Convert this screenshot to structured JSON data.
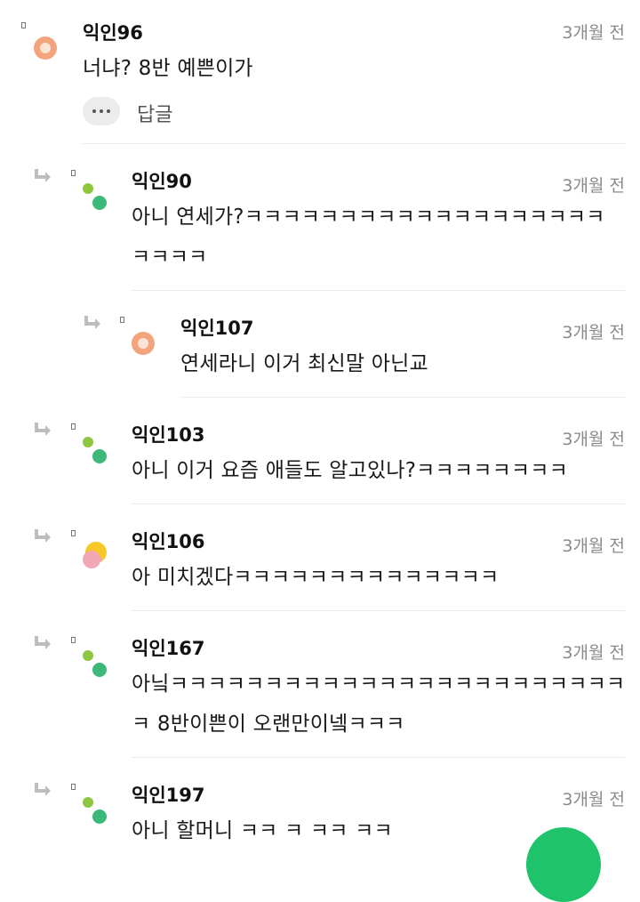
{
  "comments": [
    {
      "author": "익인96",
      "time": "3개월 전",
      "lines": [
        "너냐? 8반 예쁜이가"
      ],
      "avatar": "orange-circle-avatar"
    },
    {
      "author": "익인90",
      "time": "3개월 전",
      "lines": [
        "아니 연세가?ㅋㅋㅋㅋㅋㅋㅋㅋㅋㅋㅋㅋㅋㅋㅋㅋㅋㅋㅋ",
        "ㅋㅋㅋㅋ"
      ],
      "avatar": "green-dots-avatar"
    },
    {
      "author": "익인107",
      "time": "3개월 전",
      "lines": [
        "연세라니 이거 최신말 아닌교"
      ],
      "avatar": "orange-circle-avatar"
    },
    {
      "author": "익인103",
      "time": "3개월 전",
      "lines": [
        "아니 이거 요즘 애들도 알고있나?ㅋㅋㅋㅋㅋㅋㅋㅋ"
      ],
      "avatar": "green-dots-avatar"
    },
    {
      "author": "익인106",
      "time": "3개월 전",
      "lines": [
        "아 미치겠다ㅋㅋㅋㅋㅋㅋㅋㅋㅋㅋㅋㅋㅋㅋ"
      ],
      "avatar": "yellow-pink-avatar"
    },
    {
      "author": "익인167",
      "time": "3개월 전",
      "lines": [
        "아닠ㅋㅋㅋㅋㅋㅋㅋㅋㅋㅋㅋㅋㅋㅋㅋㅋㅋㅋㅋㅋㅋㅋㅋㅋ",
        "ㅋ 8반이쁜이 오랜만이넼ㅋㅋㅋ"
      ],
      "avatar": "green-dots-avatar"
    },
    {
      "author": "익인197",
      "time": "3개월 전",
      "lines": [
        "아니 할머니 ㅋㅋ ㅋ ㅋㅋ ㅋㅋ"
      ],
      "avatar": "green-dots-avatar"
    }
  ],
  "actions": {
    "reply_label": "답글",
    "more_icon": "more-dots-icon"
  },
  "colors": {
    "accent": "#1ec36b",
    "avatar_orange": "#f3a47c",
    "dot_light_green": "#8dc63f",
    "dot_green": "#3cb878",
    "avatar_yellow": "#f7c928",
    "avatar_pink": "#f2a8b4"
  }
}
